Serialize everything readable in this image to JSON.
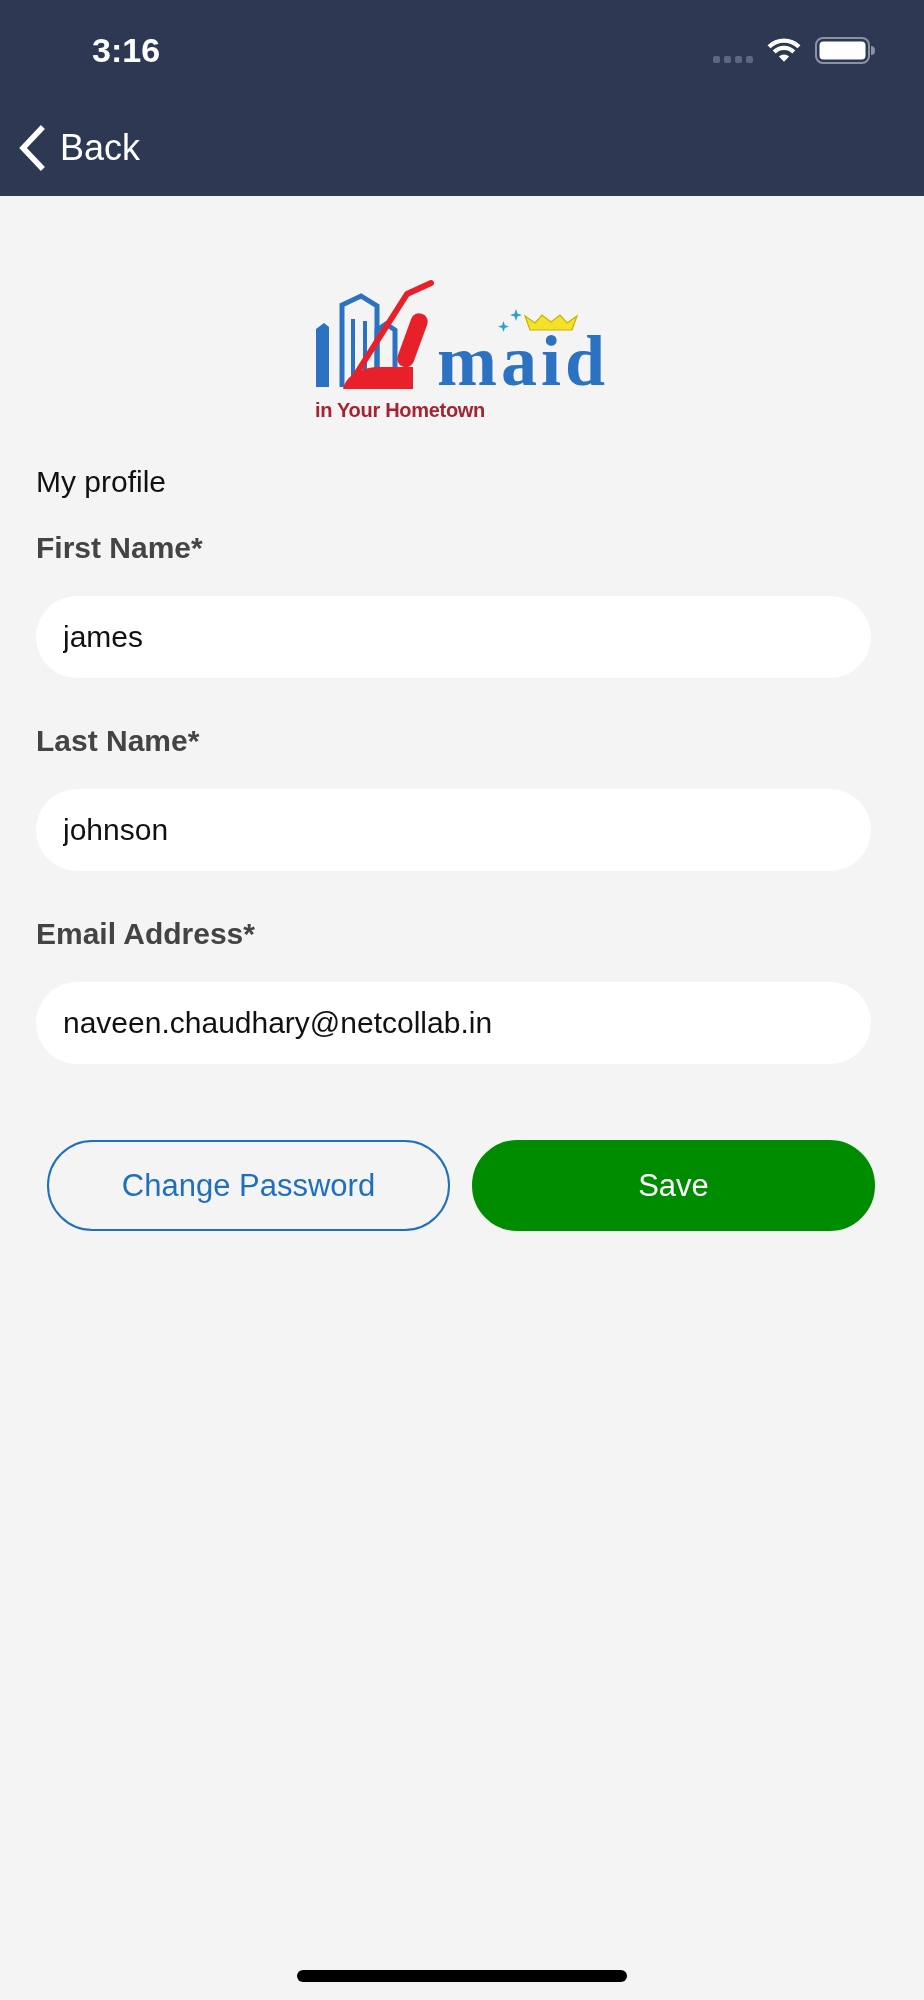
{
  "status_bar": {
    "time": "3:16"
  },
  "nav_bar": {
    "back_label": "Back"
  },
  "logo": {
    "wordmark": "maid",
    "tagline": "in Your Hometown"
  },
  "page_title": "My profile",
  "fields": [
    {
      "label": "First Name*",
      "value": "james"
    },
    {
      "label": "Last Name*",
      "value": "johnson"
    },
    {
      "label": "Email Address*",
      "value": "naveen.chaudhary@netcollab.in"
    }
  ],
  "buttons": [
    {
      "label": "Change Password",
      "kind": "outline"
    },
    {
      "label": "Save",
      "kind": "primary"
    }
  ]
}
